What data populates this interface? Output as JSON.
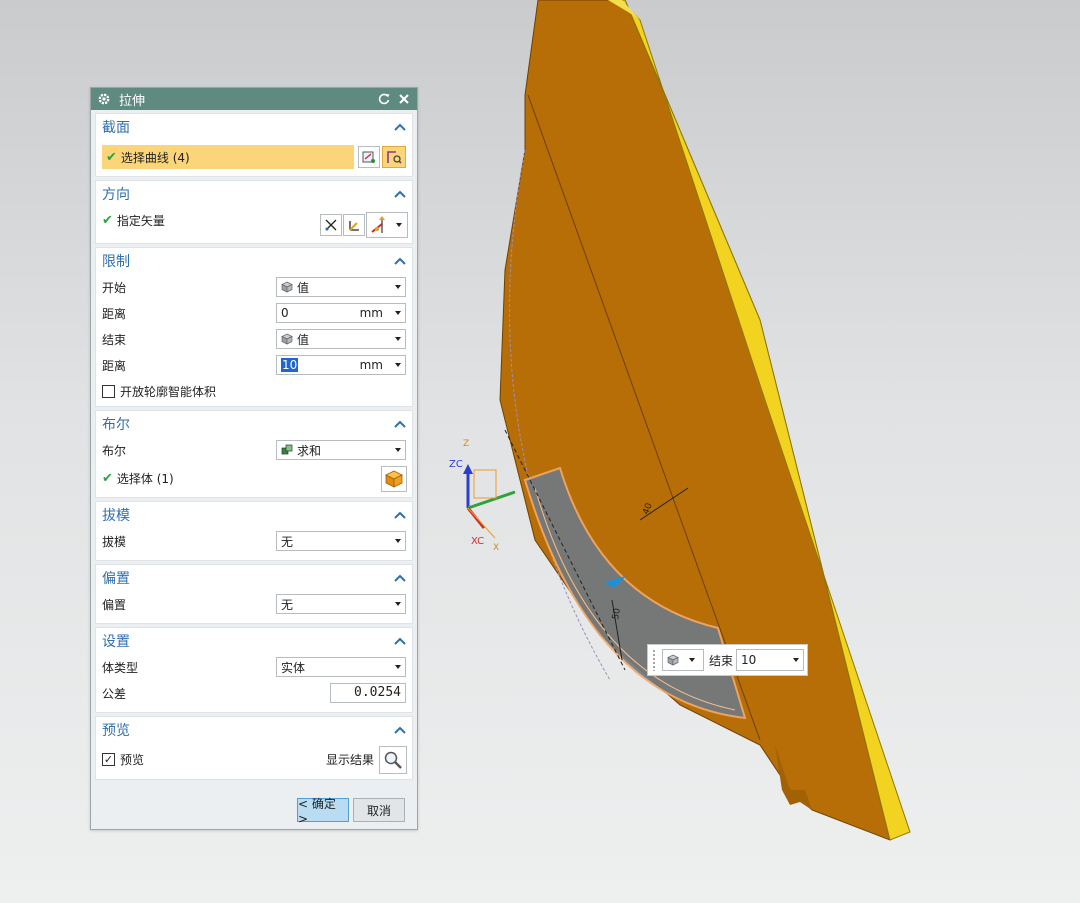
{
  "dialog": {
    "title": "拉伸",
    "sections": {
      "section": {
        "title": "截面",
        "select_curve": "选择曲线 (4)"
      },
      "direction": {
        "title": "方向",
        "vector": "指定矢量"
      },
      "limits": {
        "title": "限制",
        "start_label": "开始",
        "start_value": "值",
        "dist1_label": "距离",
        "dist1_value": "0",
        "dist1_unit": "mm",
        "end_label": "结束",
        "end_value": "值",
        "dist2_label": "距离",
        "dist2_value": "10",
        "dist2_unit": "mm",
        "open_profile": "开放轮廓智能体积"
      },
      "boolean": {
        "title": "布尔",
        "label": "布尔",
        "value": "求和",
        "select_body": "选择体 (1)"
      },
      "draft": {
        "title": "拔模",
        "label": "拔模",
        "value": "无"
      },
      "offset": {
        "title": "偏置",
        "label": "偏置",
        "value": "无"
      },
      "settings": {
        "title": "设置",
        "body_type_label": "体类型",
        "body_type_value": "实体",
        "tolerance_label": "公差",
        "tolerance_value": "0.0254"
      },
      "preview": {
        "title": "预览",
        "preview_label": "预览",
        "show_result": "显示结果"
      }
    },
    "ok_button": "< 确定 >",
    "cancel_button": "取消"
  },
  "floating_toolbar": {
    "end_label": "结束",
    "end_value": "10"
  },
  "viewport": {
    "axis_labels": {
      "z": "Z",
      "zc": "ZC",
      "xc": "XC",
      "x": "X"
    },
    "annotations": {
      "dim1": "40",
      "dim2": "50"
    }
  },
  "colors": {
    "part": "#b86e07",
    "part_edge": "#f2d320",
    "title_bar": "#5f8a80",
    "section_title": "#2f6fb0",
    "highlight": "#fcd479"
  }
}
